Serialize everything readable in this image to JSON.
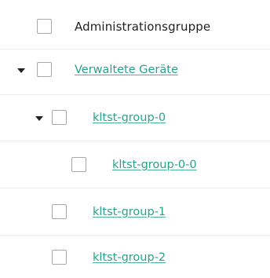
{
  "tree": {
    "header_label": "Administrationsgruppe",
    "rows": [
      {
        "label": "Verwaltete Geräte",
        "expanded": true,
        "checked": false
      },
      {
        "label": "kltst-group-0",
        "expanded": true,
        "checked": false
      },
      {
        "label": "kltst-group-0-0",
        "checked": false
      },
      {
        "label": "kltst-group-1",
        "checked": false
      },
      {
        "label": "kltst-group-2",
        "checked": false
      }
    ]
  },
  "colors": {
    "link": "#27a38a",
    "checkbox_border": "#a7a7a7",
    "row_divider": "#ececec",
    "header_text": "#1f1f1f",
    "toggle_arrow": "#222222"
  }
}
